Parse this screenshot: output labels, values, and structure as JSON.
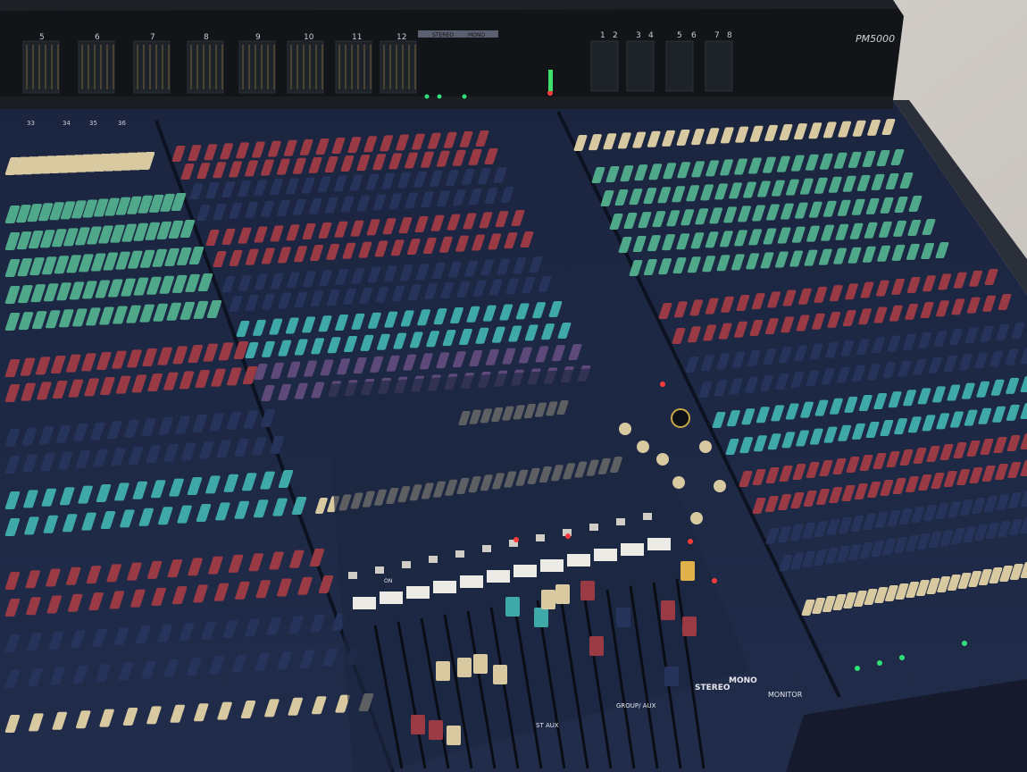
{
  "meter_bridge": {
    "model_badge": "PM5000",
    "channel_numbers": [
      "5",
      "6",
      "7",
      "8",
      "9",
      "10",
      "11",
      "12"
    ],
    "stereo_label": "STEREO",
    "mono_label": "MONO",
    "group_numbers": [
      "1",
      "2",
      "3",
      "4",
      "5",
      "6",
      "7",
      "8"
    ]
  },
  "channel_strip_numbers": [
    "33",
    "34",
    "35",
    "36"
  ],
  "master_section": {
    "stereo_label": "STEREO",
    "mono_label": "MONO",
    "monitor_label": "MONITOR",
    "group_aux_label": "GROUP/ AUX",
    "st_aux_label": "ST AUX",
    "on_label": "ON"
  },
  "colors": {
    "panel": "#1e2a44",
    "meter_bridge": "#121417",
    "knob_red": "#9a3a44",
    "knob_navy": "#26335a",
    "knob_teal": "#3fa9a9",
    "knob_purple": "#5d4a7a",
    "knob_green": "#4fa88a",
    "knob_cream": "#d8c9a0",
    "led_green": "#31e07a",
    "led_red": "#ff3a3a",
    "floor": "#cfcbc6"
  }
}
